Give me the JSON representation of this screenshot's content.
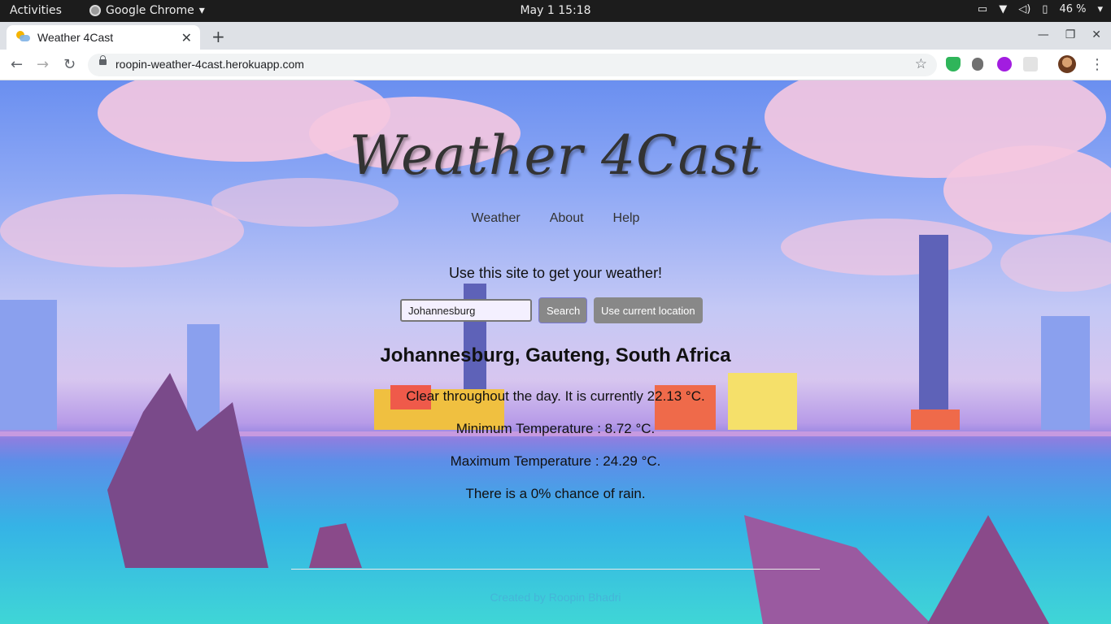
{
  "system_bar": {
    "activities": "Activities",
    "app_name": "Google Chrome",
    "clock": "May 1  15:18",
    "battery": "46 %"
  },
  "browser": {
    "tab_title": "Weather 4Cast",
    "url": "roopin-weather-4cast.herokuapp.com"
  },
  "site": {
    "title": "Weather 4Cast",
    "nav": [
      "Weather",
      "About",
      "Help"
    ],
    "subtitle": "Use this site to get your weather!",
    "search": {
      "value": "Johannesburg",
      "button": "Search",
      "location_button": "Use current location"
    },
    "location": "Johannesburg, Gauteng, South Africa",
    "forecast": {
      "summary": "Clear throughout the day. It is currently 22.13 °C.",
      "min": "Minimum Temperature : 8.72 °C.",
      "max": "Maximum Temperature : 24.29 °C.",
      "rain": "There is a 0% chance of rain."
    },
    "footer": "Created by Roopin Bhadri"
  },
  "colors": {
    "sky_top": "#6a8ff0",
    "water": "#3fd6d6",
    "cloud_pink": "#f5c8e0",
    "button_gray": "#888888"
  }
}
